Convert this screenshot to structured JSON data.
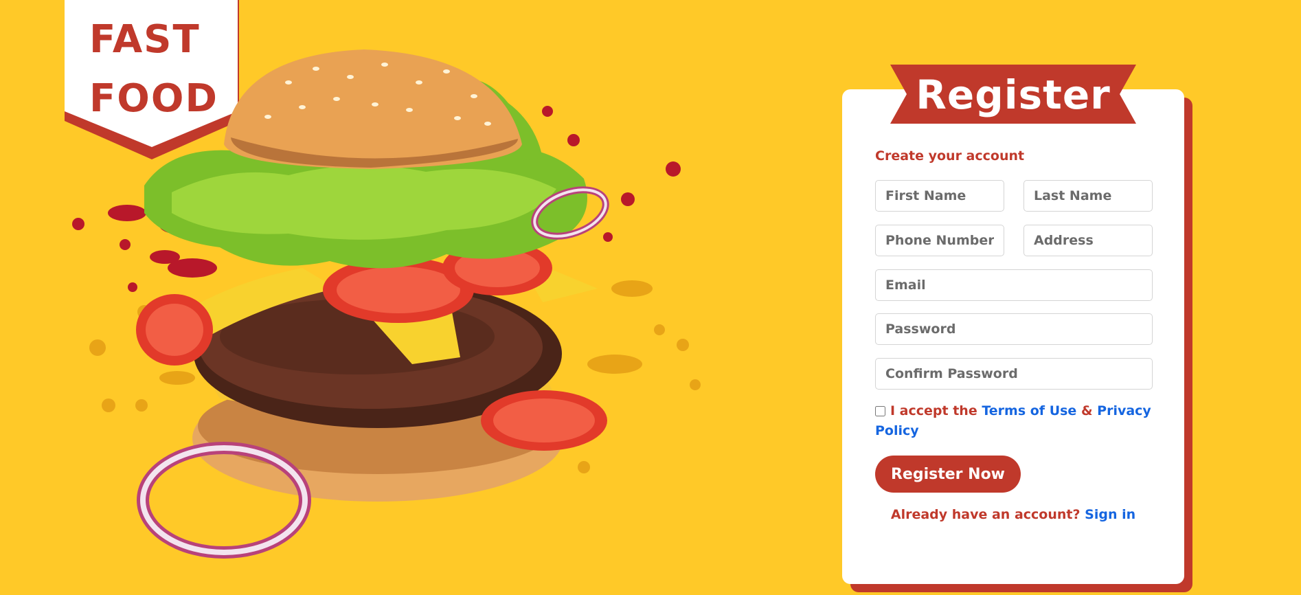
{
  "logo": {
    "line1": "FAST",
    "line2": "FOOD"
  },
  "form": {
    "title": "Register",
    "subtitle": "Create your account",
    "first_name_placeholder": "First Name",
    "last_name_placeholder": "Last Name",
    "phone_placeholder": "Phone Number",
    "address_placeholder": "Address",
    "email_placeholder": "Email",
    "password_placeholder": "Password",
    "confirm_password_placeholder": "Confirm Password",
    "terms": {
      "prefix": "I accept the",
      "terms_link": "Terms of Use",
      "ampersand": "&",
      "privacy_link": "Privacy Policy"
    },
    "submit_label": "Register Now",
    "signin_prompt": "Already have an account?",
    "signin_link": "Sign in"
  },
  "colors": {
    "background": "#FFC928",
    "brand_red": "#C0392B",
    "link_blue": "#1565E0",
    "card": "#FFFFFF"
  },
  "icons": {
    "hero_image": "burger-illustration"
  }
}
